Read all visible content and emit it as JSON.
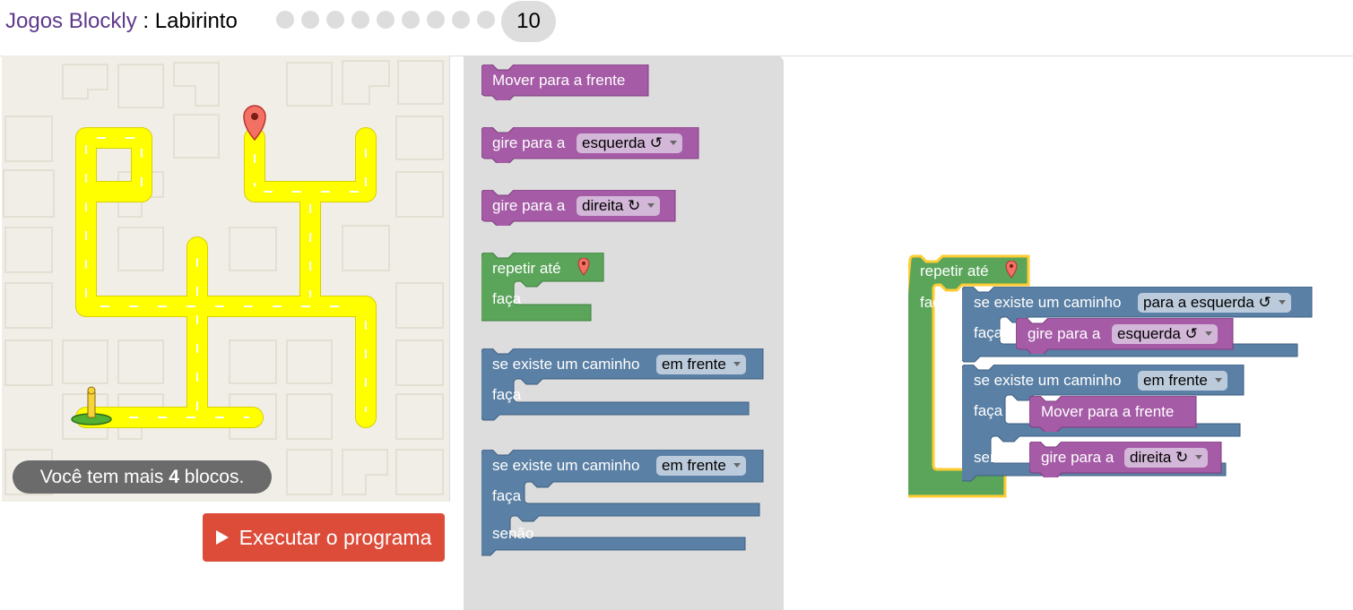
{
  "header": {
    "app_name": "Jogos Blockly",
    "separator": " : ",
    "page": "Labirinto",
    "level": "10",
    "level_dots": 9
  },
  "maze": {
    "message_before": "Você tem mais ",
    "blocks_left": "4",
    "message_after": " blocos.",
    "start_icon": "pegman-icon",
    "goal_icon": "map-marker-icon"
  },
  "run_button": {
    "label": "Executar o programa",
    "icon": "play-icon"
  },
  "toolbox": {
    "move_forward": "Mover para a frente",
    "turn_left": {
      "label": "gire para a",
      "option": "esquerda ↺"
    },
    "turn_right": {
      "label": "gire para a",
      "option": "direita ↻"
    },
    "repeat": {
      "label": "repetir até",
      "do": "faça"
    },
    "if": {
      "label": "se existe um caminho",
      "option": "em frente",
      "do": "faça"
    },
    "if_else": {
      "label": "se existe um caminho",
      "option": "em frente",
      "do": "faça",
      "else": "senão"
    }
  },
  "workspace": {
    "repeat": {
      "label": "repetir até",
      "do": "faça"
    },
    "if_left": {
      "label": "se existe um caminho",
      "option": "para a esquerda ↺",
      "do": "faça"
    },
    "turn_left": {
      "label": "gire para a",
      "option": "esquerda ↺"
    },
    "if_else": {
      "label": "se existe um caminho",
      "option": "em frente",
      "do": "faça",
      "else": "senão"
    },
    "move": "Mover para a frente",
    "turn_right": {
      "label": "gire para a",
      "option": "direita ↻"
    }
  },
  "colors": {
    "title_link": "#5e3a8c",
    "path": "#ffff00",
    "movement_block": "#a55ba6",
    "loop_block": "#5ba55b",
    "logic_block": "#5b80a5",
    "run_button": "#dd4b39",
    "selection": "#fc3"
  }
}
